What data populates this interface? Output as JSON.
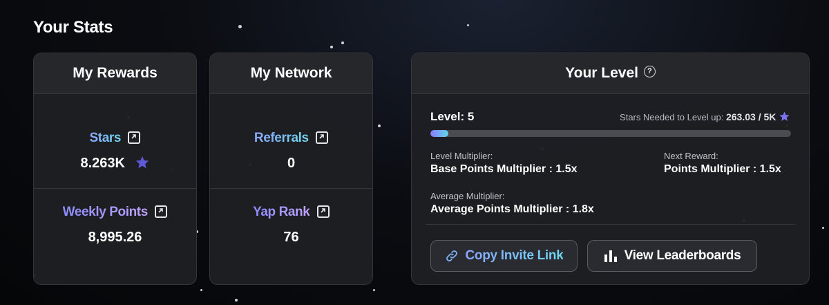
{
  "section_title": "Your Stats",
  "rewards": {
    "header": "My Rewards",
    "stars_label": "Stars",
    "stars_value": "8.263K",
    "weekly_label": "Weekly Points",
    "weekly_value": "8,995.26"
  },
  "network": {
    "header": "My Network",
    "referrals_label": "Referrals",
    "referrals_value": "0",
    "rank_label": "Yap Rank",
    "rank_value": "76"
  },
  "level": {
    "header": "Your Level",
    "level_text": "Level: 5",
    "needed_label": "Stars Needed to Level up:",
    "needed_value": "263.03 / 5K",
    "progress_fraction": 0.05,
    "level_multiplier_label": "Level Multiplier:",
    "level_multiplier_value": "Base Points Multiplier : 1.5x",
    "next_reward_label": "Next Reward:",
    "next_reward_value": "Points Multiplier : 1.5x",
    "average_multiplier_label": "Average Multiplier:",
    "average_multiplier_value": "Average Points Multiplier : 1.8x",
    "copy_button": "Copy Invite Link",
    "leaderboard_button": "View Leaderboards"
  },
  "colors": {
    "accent_gradient_start": "#8ba7ff",
    "accent_gradient_end": "#6dd6ee",
    "star_color": "#6f6af0"
  },
  "icons": [
    "external-link-icon",
    "star-icon",
    "help-icon",
    "link-icon",
    "bar-chart-icon"
  ]
}
